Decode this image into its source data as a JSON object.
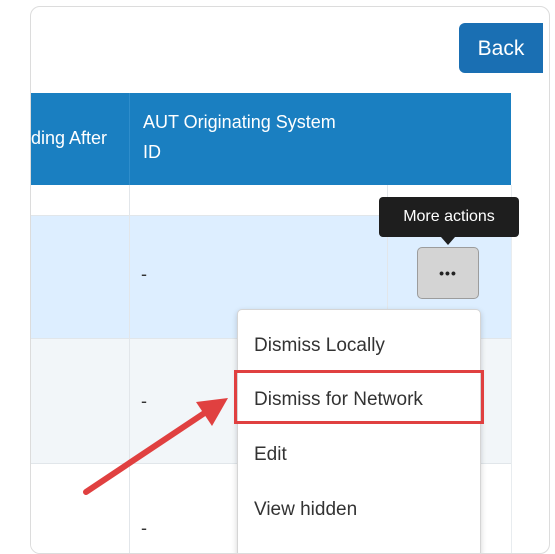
{
  "toolbar": {
    "back_label": "Back"
  },
  "table": {
    "headers": [
      "ding After",
      "AUT Originating System ID"
    ],
    "rows": [
      {
        "value": ""
      },
      {
        "value": "-"
      },
      {
        "value": "-"
      },
      {
        "value": "-"
      }
    ]
  },
  "row_actions": {
    "more_label": "•••",
    "tooltip": "More actions"
  },
  "menu": {
    "items": [
      "Dismiss Locally",
      "Dismiss for Network",
      "Edit",
      "View hidden"
    ]
  },
  "colors": {
    "header_bg": "#1a7fc1",
    "back_button_bg": "#1a6fb3",
    "selected_row_bg": "#ddeeff",
    "annotation_red": "#e04040"
  },
  "icons": {
    "more": "ellipsis-icon",
    "annotation": "red-arrow-icon"
  }
}
